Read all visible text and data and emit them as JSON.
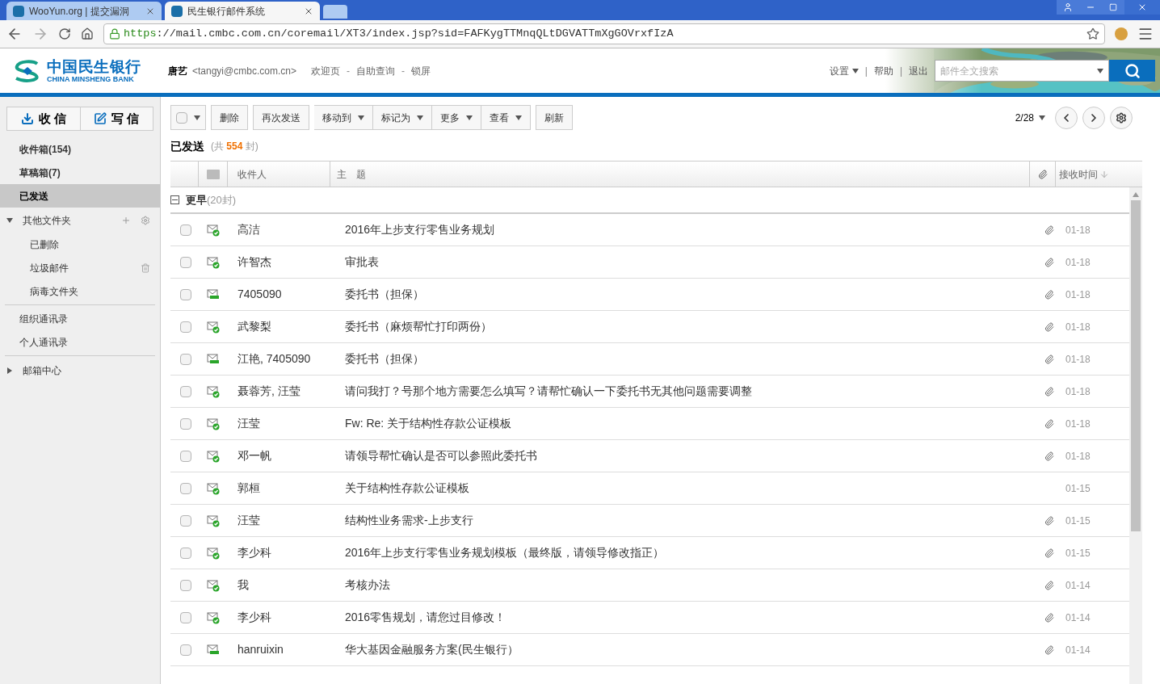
{
  "browser": {
    "tabs": [
      {
        "title": "WooYun.org | 提交漏洞",
        "selected": false
      },
      {
        "title": "民生银行邮件系统",
        "selected": true
      }
    ],
    "url_scheme": "https",
    "url_rest": "://mail.cmbc.com.cn/coremail/XT3/index.jsp?sid=FAFKygTTMnqQLtDGVATTmXgGOVrxfIzA"
  },
  "header": {
    "logo_cn": "中国民生银行",
    "logo_en": "CHINA MINSHENG BANK",
    "user_name": "唐艺",
    "user_email": "<tangyi@cmbc.com.cn>",
    "links": [
      "欢迎页",
      "自助查询",
      "锁屏"
    ],
    "separator": "-",
    "right_separator": "|",
    "right_links": [
      {
        "label": "设置",
        "dropdown": true
      },
      {
        "label": "帮助",
        "dropdown": false
      },
      {
        "label": "退出",
        "dropdown": false
      }
    ],
    "search": {
      "placeholder": "邮件全文搜索"
    }
  },
  "sidebar": {
    "actions": [
      "收 信",
      "写 信"
    ],
    "folders": [
      {
        "label": "收件箱(154)",
        "selected": false
      },
      {
        "label": "草稿箱(7)",
        "selected": false
      },
      {
        "label": "已发送",
        "selected": true
      }
    ],
    "other": {
      "label": "其他文件夹",
      "expanded": true,
      "children": [
        {
          "label": "已删除",
          "selected": false
        },
        {
          "label": "垃圾邮件",
          "selected": false
        },
        {
          "label": "病毒文件夹",
          "selected": false
        }
      ]
    },
    "contacts": [
      "组织通讯录",
      "个人通讯录"
    ],
    "center": {
      "label": "邮箱中心",
      "expanded": false
    }
  },
  "toolbar": {
    "buttons": [
      {
        "kind": "select",
        "checked": false
      },
      {
        "kind": "plain",
        "label": "删除"
      },
      {
        "kind": "plain",
        "label": "再次发送"
      },
      {
        "kind": "menu",
        "label": "移动到"
      },
      {
        "kind": "menu",
        "label": "标记为"
      },
      {
        "kind": "menu",
        "label": "更多"
      },
      {
        "kind": "menu",
        "label": "查看"
      },
      {
        "kind": "plain",
        "label": "刷新"
      }
    ],
    "page": "2/28"
  },
  "folder_title": "已发送",
  "folder_count": "(共 **554** 封)",
  "table": {
    "columns": [
      "收件人",
      "主　题",
      "接收时间"
    ],
    "group": {
      "label": "更早",
      "count": "(20封)",
      "expanded": true
    },
    "rows": [
      {
        "to": "高洁",
        "subject": "2016年上步支行零售业务规划",
        "date": "01-18",
        "kind": "replied",
        "attachment": true,
        "checked": false
      },
      {
        "to": "许智杰",
        "subject": "审批表",
        "date": "01-18",
        "kind": "replied",
        "attachment": true,
        "checked": false
      },
      {
        "to": "7405090",
        "subject": "委托书（担保）",
        "date": "01-18",
        "kind": "sent",
        "attachment": true,
        "checked": false
      },
      {
        "to": "武黎梨",
        "subject": "委托书（麻烦帮忙打印两份）",
        "date": "01-18",
        "kind": "replied",
        "attachment": true,
        "checked": false
      },
      {
        "to": "江艳, 7405090",
        "subject": "委托书（担保）",
        "date": "01-18",
        "kind": "sent",
        "attachment": true,
        "checked": false
      },
      {
        "to": "聂蓉芳, 汪莹",
        "subject": "请问我打？号那个地方需要怎么填写？请帮忙确认一下委托书无其他问题需要调整",
        "date": "01-18",
        "kind": "replied",
        "attachment": true,
        "checked": false
      },
      {
        "to": "汪莹",
        "subject": "Fw: Re: 关于结构性存款公证模板",
        "date": "01-18",
        "kind": "replied",
        "attachment": true,
        "checked": false
      },
      {
        "to": "邓一帆",
        "subject": "请领导帮忙确认是否可以参照此委托书",
        "date": "01-18",
        "kind": "replied",
        "attachment": true,
        "checked": false
      },
      {
        "to": "郭桓",
        "subject": "关于结构性存款公证模板",
        "date": "01-15",
        "kind": "replied",
        "attachment": false,
        "checked": false
      },
      {
        "to": "汪莹",
        "subject": "结构性业务需求-上步支行",
        "date": "01-15",
        "kind": "replied",
        "attachment": true,
        "checked": false
      },
      {
        "to": "李少科",
        "subject": "2016年上步支行零售业务规划模板（最终版，请领导修改指正）",
        "date": "01-15",
        "kind": "replied",
        "attachment": true,
        "checked": false
      },
      {
        "to": "我",
        "subject": "考核办法",
        "date": "01-14",
        "kind": "replied",
        "attachment": true,
        "checked": false
      },
      {
        "to": "李少科",
        "subject": "2016零售规划，请您过目修改！",
        "date": "01-14",
        "kind": "replied",
        "attachment": true,
        "checked": false
      },
      {
        "to": "hanruixin",
        "subject": "华大基因金融服务方案(民生银行）",
        "date": "01-14",
        "kind": "sent",
        "attachment": true,
        "checked": false
      }
    ]
  }
}
